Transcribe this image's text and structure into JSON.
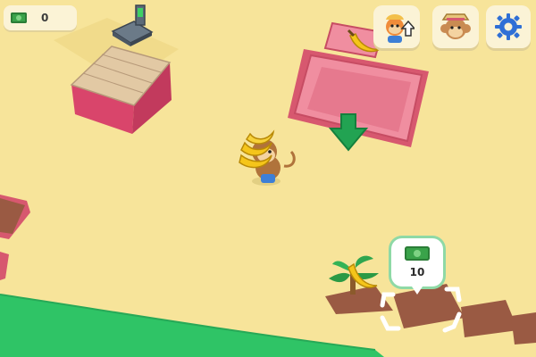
{
  "hud": {
    "money_value": "0",
    "buttons": [
      {
        "name": "upgrade-worker-button",
        "icon": "worker-upgrade-icon"
      },
      {
        "name": "hire-monkey-button",
        "icon": "monkey-face-icon"
      },
      {
        "name": "settings-button",
        "icon": "gear-icon"
      }
    ]
  },
  "plot_purchase": {
    "cost": "10",
    "icon": "cash-icon"
  },
  "world": {
    "cash_register_counter": "cash-register-icon",
    "banana_crate": "banana-icon",
    "drop_arrow": "down-arrow-icon",
    "player": "monkey-carrying-bananas",
    "banana_tree": "palm-tree-icon"
  },
  "colors": {
    "sand": "#f7e49a",
    "grass": "#2fc466",
    "crate_pink": "#e8708a",
    "arrow_green": "#22a352",
    "soil": "#9a5a43"
  }
}
